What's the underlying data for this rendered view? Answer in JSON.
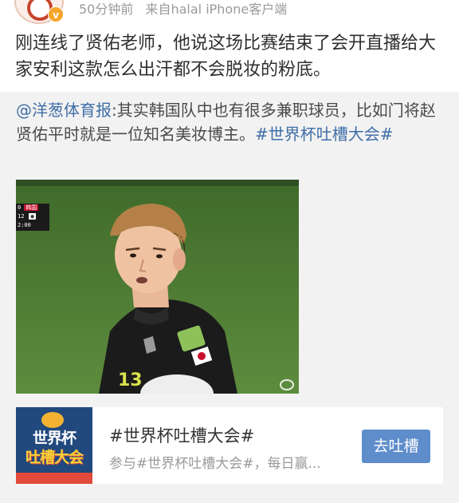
{
  "header": {
    "time": "50分钟前",
    "source": "来自halal iPhone客户端",
    "verified_badge": "v"
  },
  "post": {
    "text": "刚连线了贤佑老师，他说这场比赛结束了会开直播给大家安利这款怎么出汗都不会脱妆的粉底。"
  },
  "repost": {
    "mention": "@洋葱体育报",
    "body": ":其实韩国队中也有很多兼职球员，比如门将赵贤佑平时就是一位知名美妆博主。",
    "hashtag": "#世界杯吐槽大会#"
  },
  "media": {
    "scoreboard": {
      "row1_score": "0",
      "row1_team": "韩国",
      "row2_score": "12",
      "clock": "2:00"
    },
    "icons": [
      "weibo-watermark-icon"
    ]
  },
  "topic_card": {
    "thumb_line1": "世界杯",
    "thumb_line2": "吐槽大会",
    "title": "#世界杯吐槽大会#",
    "subtitle": "参与#世界杯吐槽大会#，每日赢...",
    "button_label": "去吐槽"
  },
  "colors": {
    "link": "#3f6ea8",
    "button": "#5f8dcc",
    "repost_bg": "#f2f2f2",
    "meta_text": "#9a9a9a"
  }
}
